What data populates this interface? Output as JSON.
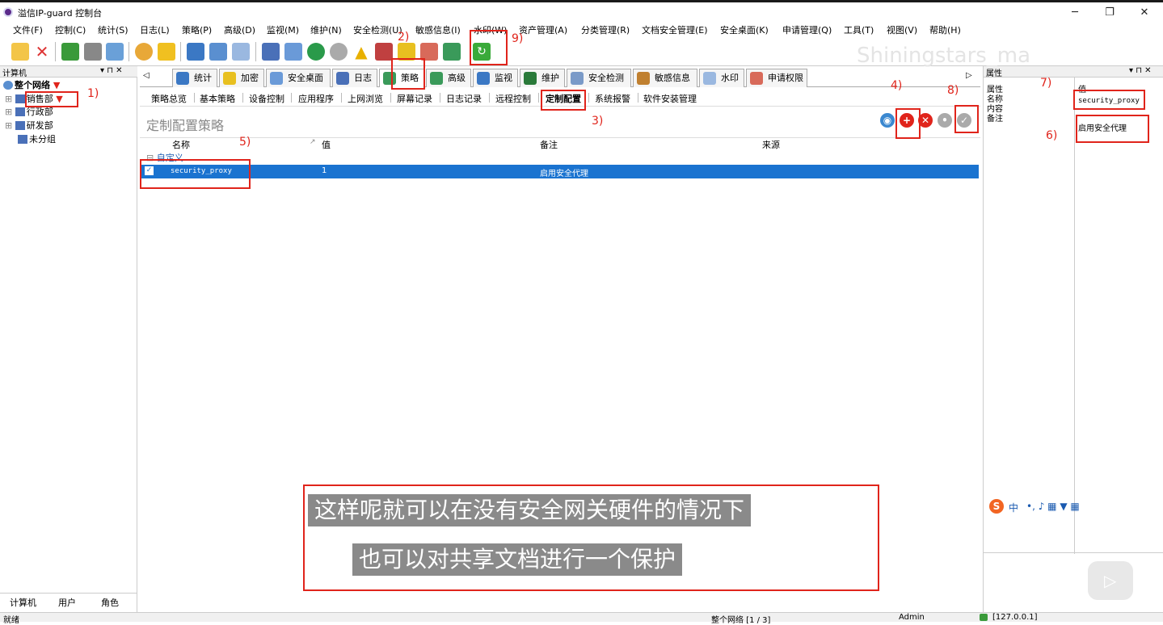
{
  "window": {
    "title": "溢信IP-guard 控制台"
  },
  "menu": [
    "文件(F)",
    "控制(C)",
    "统计(S)",
    "日志(L)",
    "策略(P)",
    "高级(D)",
    "监视(M)",
    "维护(N)",
    "安全检测(U)",
    "敏感信息(I)",
    "水印(W)",
    "资产管理(A)",
    "分类管理(R)",
    "文档安全管理(E)",
    "安全桌面(K)",
    "申请管理(Q)",
    "工具(T)",
    "视图(V)",
    "帮助(H)"
  ],
  "watermark": "Shiningstars_ma",
  "left_panel": {
    "title": "计算机",
    "tree": [
      {
        "label": "整个网络"
      },
      {
        "label": "销售部"
      },
      {
        "label": "行政部"
      },
      {
        "label": "研发部"
      },
      {
        "label": "未分组"
      }
    ],
    "bottom_tabs": [
      "计算机",
      "用户",
      "角色"
    ]
  },
  "tabs": [
    "统计",
    "加密",
    "安全桌面",
    "日志",
    "策略",
    "高级",
    "监视",
    "维护",
    "安全检测",
    "敏感信息",
    "水印",
    "申请权限"
  ],
  "subtabs": [
    "策略总览",
    "基本策略",
    "设备控制",
    "应用程序",
    "上网浏览",
    "屏幕记录",
    "日志记录",
    "远程控制",
    "定制配置",
    "系统报警",
    "软件安装管理"
  ],
  "policy": {
    "title": "定制配置策略",
    "columns": {
      "name": "名称",
      "value": "值",
      "note": "备注",
      "source": "来源"
    },
    "group": "自定义",
    "row": {
      "name": "security_proxy",
      "value": "1",
      "note": "启用安全代理",
      "source": ""
    }
  },
  "right_panel": {
    "title": "属性",
    "header": {
      "key": "属性",
      "value": "值"
    },
    "props": [
      {
        "key": "名称",
        "value": "security_proxy"
      },
      {
        "key": "内容",
        "value": ""
      },
      {
        "key": "备注",
        "value": "启用安全代理"
      }
    ]
  },
  "status": {
    "left": "就绪",
    "network": "整个网络 [1 / 3]",
    "user": "Admin",
    "ip": "[127.0.0.1]"
  },
  "annotations": [
    "1)",
    "2)",
    "3)",
    "4)",
    "5)",
    "6)",
    "7)",
    "8)",
    "9)"
  ],
  "subtitles": [
    "这样呢就可以在没有安全网关硬件的情况下",
    "也可以对共享文档进行一个保护"
  ],
  "ime": {
    "label": "中"
  }
}
